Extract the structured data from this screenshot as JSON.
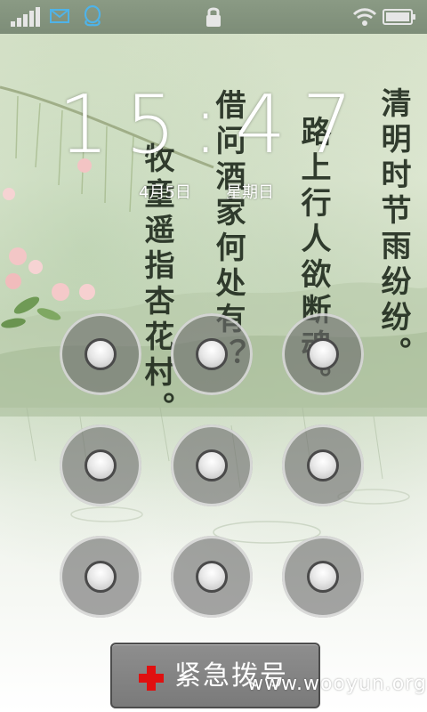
{
  "status_bar": {
    "icons": [
      "signal-icon",
      "mail-icon",
      "qq-icon",
      "lock-icon",
      "wifi-icon",
      "battery-icon"
    ]
  },
  "clock": {
    "time": "15:47",
    "date": "4月5日",
    "weekday": "星期日"
  },
  "poem": {
    "line1": "清明时节雨纷纷。",
    "line2": "路上行人欲断魂。",
    "line3": "借问酒家何处有？",
    "line4": "牧童遥指杏花村。"
  },
  "pattern": {
    "rows": 3,
    "cols": 3
  },
  "emergency": {
    "label": "紧急拨号"
  },
  "watermark": {
    "text": "www.wooyun.org"
  },
  "colors": {
    "status_bar": "#7d8d78",
    "accent_blue": "#4fb3e8",
    "emergency_cross": "#e01010"
  }
}
